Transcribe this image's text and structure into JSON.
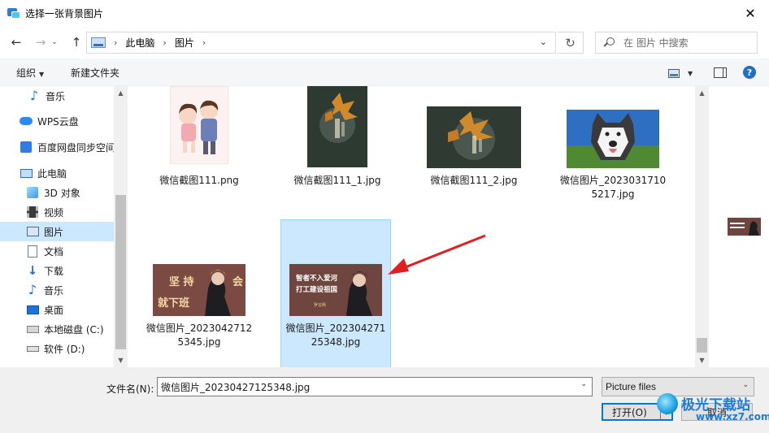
{
  "window": {
    "title": "选择一张背景图片",
    "close_glyph": "✕"
  },
  "nav": {
    "back_glyph": "←",
    "forward_glyph": "→",
    "history_glyph": "⌄",
    "up_glyph": "↑",
    "refresh_glyph": "↻",
    "breadcrumb": [
      "此电脑",
      "图片"
    ],
    "breadcrumb_sep": "›",
    "search_placeholder": "在 图片 中搜索"
  },
  "toolbar": {
    "organize_label": "组织",
    "new_folder_label": "新建文件夹",
    "help_glyph": "?"
  },
  "sidebar": {
    "items": [
      {
        "label": "音乐",
        "icon": "music-icon"
      },
      {
        "label": "WPS云盘",
        "icon": "cloud-icon"
      },
      {
        "label": "百度网盘同步空间",
        "icon": "baidu-netdisk-icon"
      },
      {
        "label": "此电脑",
        "icon": "this-pc-icon"
      },
      {
        "label": "3D 对象",
        "icon": "3d-objects-icon"
      },
      {
        "label": "视频",
        "icon": "video-icon"
      },
      {
        "label": "图片",
        "icon": "pictures-icon",
        "selected": true
      },
      {
        "label": "文档",
        "icon": "documents-icon"
      },
      {
        "label": "下载",
        "icon": "downloads-icon"
      },
      {
        "label": "音乐",
        "icon": "music-icon"
      },
      {
        "label": "桌面",
        "icon": "desktop-icon"
      },
      {
        "label": "本地磁盘 (C:)",
        "icon": "drive-c-icon"
      },
      {
        "label": "软件 (D:)",
        "icon": "drive-d-icon"
      }
    ]
  },
  "files": [
    {
      "name": "微信截图111.png"
    },
    {
      "name": "微信截图111_1.jpg"
    },
    {
      "name": "微信截图111_2.jpg"
    },
    {
      "name": "微信图片_20230317105217.jpg"
    },
    {
      "name": "微信图片_20230427125345.jpg",
      "thumb_text_1": "坚 持",
      "thumb_text_2": "会",
      "thumb_text_3": "就下班"
    },
    {
      "name": "微信图片_20230427125348.jpg",
      "selected": true,
      "thumb_text_1": "智者不入爱河",
      "thumb_text_2": "打工建设祖国",
      "thumb_text_3": "罗云熙"
    }
  ],
  "bottom": {
    "filename_label": "文件名(N):",
    "filename_value": "微信图片_20230427125348.jpg",
    "filetype_value": "Picture files",
    "open_label": "打开(O)",
    "cancel_label": "取消"
  },
  "watermark": {
    "brand": "极光下载站",
    "url": "www.xz7.com"
  },
  "colors": {
    "selection": "#cce8ff",
    "accent": "#0078d7",
    "arrow": "#e02020"
  }
}
